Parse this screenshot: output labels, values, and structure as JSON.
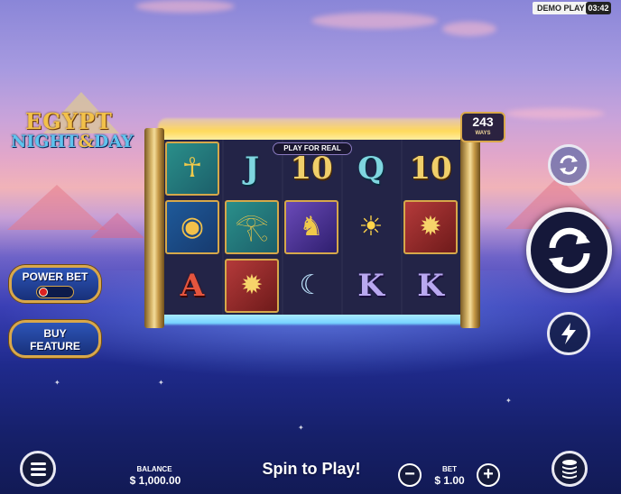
{
  "status": {
    "mode_badge": "DEMO PLAY",
    "clock": "03:42"
  },
  "game": {
    "logo_line1": "EGYPT",
    "logo_line2_a": "NIGHT",
    "logo_amp": "&",
    "logo_line2_b": "DAY"
  },
  "reels": {
    "banner": "PLAY FOR REAL",
    "ways_count": "243",
    "ways_label": "WAYS",
    "grid": [
      [
        {
          "kind": "tile",
          "theme": "teal",
          "icon": "ankh-icon",
          "glyph": "☥",
          "color": "#f0c94a"
        },
        {
          "kind": "tile",
          "theme": "blue",
          "icon": "blue-gold-disc-icon",
          "glyph": "◉",
          "color": "#f2c14a"
        },
        {
          "kind": "letter",
          "text": "A",
          "style": "l-red"
        }
      ],
      [
        {
          "kind": "letter",
          "text": "J",
          "style": "l-teal"
        },
        {
          "kind": "tile",
          "theme": "teal",
          "icon": "eye-of-horus-icon",
          "glyph": "𓂀",
          "color": "#f0c94a"
        },
        {
          "kind": "tile",
          "theme": "red",
          "icon": "scarab-icon",
          "glyph": "✹",
          "color": "#f7d46a"
        }
      ],
      [
        {
          "kind": "letter",
          "text": "10",
          "style": "l-gold"
        },
        {
          "kind": "tile",
          "theme": "purple",
          "icon": "anubis-icon",
          "glyph": "♞",
          "color": "#f0c94a"
        },
        {
          "kind": "free",
          "icon": "moon-icon",
          "glyph": "☾",
          "color": "#bfe6ff"
        }
      ],
      [
        {
          "kind": "letter",
          "text": "Q",
          "style": "l-teal"
        },
        {
          "kind": "free",
          "icon": "sun-icon",
          "glyph": "☀",
          "color": "#ffd54a"
        },
        {
          "kind": "letter",
          "text": "K",
          "style": "l-lav"
        }
      ],
      [
        {
          "kind": "letter",
          "text": "10",
          "style": "l-gold"
        },
        {
          "kind": "tile",
          "theme": "red",
          "icon": "scarab-icon",
          "glyph": "✹",
          "color": "#f7d46a"
        },
        {
          "kind": "letter",
          "text": "K",
          "style": "l-lav"
        }
      ]
    ]
  },
  "left_buttons": {
    "power_bet": "POWER BET",
    "buy_feature_1": "BUY",
    "buy_feature_2": "FEATURE"
  },
  "bottom": {
    "balance_label": "BALANCE",
    "balance_value": "$ 1,000.00",
    "spin_prompt": "Spin to Play!",
    "bet_label": "BET",
    "bet_value": "$ 1.00",
    "minus": "−",
    "plus": "+"
  },
  "icons": {
    "menu": "menu-icon",
    "autoplay": "autoplay-icon",
    "spin": "spin-icon",
    "turbo": "lightning-icon",
    "coins": "coin-stack-icon"
  }
}
